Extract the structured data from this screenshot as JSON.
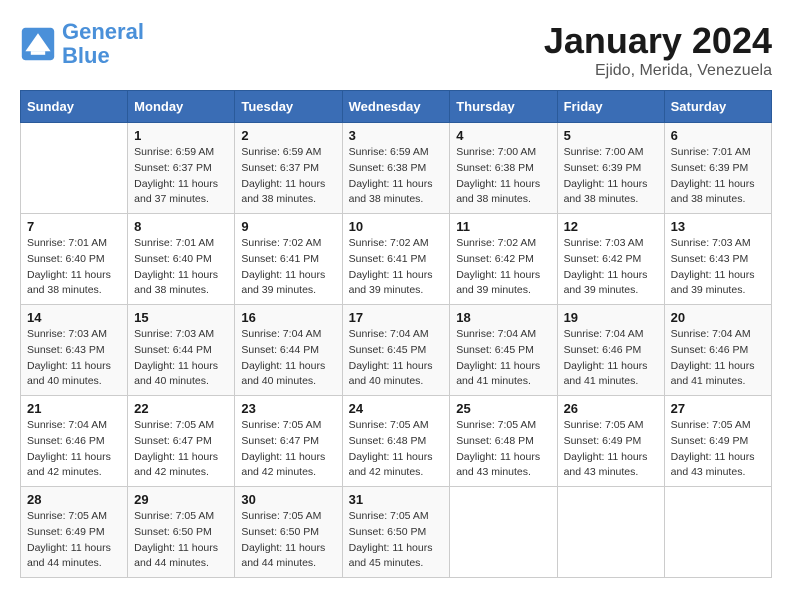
{
  "header": {
    "logo_line1": "General",
    "logo_line2": "Blue",
    "title": "January 2024",
    "subtitle": "Ejido, Merida, Venezuela"
  },
  "weekdays": [
    "Sunday",
    "Monday",
    "Tuesday",
    "Wednesday",
    "Thursday",
    "Friday",
    "Saturday"
  ],
  "weeks": [
    [
      {
        "day": "",
        "sunrise": "",
        "sunset": "",
        "daylight": ""
      },
      {
        "day": "1",
        "sunrise": "Sunrise: 6:59 AM",
        "sunset": "Sunset: 6:37 PM",
        "daylight": "Daylight: 11 hours and 37 minutes."
      },
      {
        "day": "2",
        "sunrise": "Sunrise: 6:59 AM",
        "sunset": "Sunset: 6:37 PM",
        "daylight": "Daylight: 11 hours and 38 minutes."
      },
      {
        "day": "3",
        "sunrise": "Sunrise: 6:59 AM",
        "sunset": "Sunset: 6:38 PM",
        "daylight": "Daylight: 11 hours and 38 minutes."
      },
      {
        "day": "4",
        "sunrise": "Sunrise: 7:00 AM",
        "sunset": "Sunset: 6:38 PM",
        "daylight": "Daylight: 11 hours and 38 minutes."
      },
      {
        "day": "5",
        "sunrise": "Sunrise: 7:00 AM",
        "sunset": "Sunset: 6:39 PM",
        "daylight": "Daylight: 11 hours and 38 minutes."
      },
      {
        "day": "6",
        "sunrise": "Sunrise: 7:01 AM",
        "sunset": "Sunset: 6:39 PM",
        "daylight": "Daylight: 11 hours and 38 minutes."
      }
    ],
    [
      {
        "day": "7",
        "sunrise": "Sunrise: 7:01 AM",
        "sunset": "Sunset: 6:40 PM",
        "daylight": "Daylight: 11 hours and 38 minutes."
      },
      {
        "day": "8",
        "sunrise": "Sunrise: 7:01 AM",
        "sunset": "Sunset: 6:40 PM",
        "daylight": "Daylight: 11 hours and 38 minutes."
      },
      {
        "day": "9",
        "sunrise": "Sunrise: 7:02 AM",
        "sunset": "Sunset: 6:41 PM",
        "daylight": "Daylight: 11 hours and 39 minutes."
      },
      {
        "day": "10",
        "sunrise": "Sunrise: 7:02 AM",
        "sunset": "Sunset: 6:41 PM",
        "daylight": "Daylight: 11 hours and 39 minutes."
      },
      {
        "day": "11",
        "sunrise": "Sunrise: 7:02 AM",
        "sunset": "Sunset: 6:42 PM",
        "daylight": "Daylight: 11 hours and 39 minutes."
      },
      {
        "day": "12",
        "sunrise": "Sunrise: 7:03 AM",
        "sunset": "Sunset: 6:42 PM",
        "daylight": "Daylight: 11 hours and 39 minutes."
      },
      {
        "day": "13",
        "sunrise": "Sunrise: 7:03 AM",
        "sunset": "Sunset: 6:43 PM",
        "daylight": "Daylight: 11 hours and 39 minutes."
      }
    ],
    [
      {
        "day": "14",
        "sunrise": "Sunrise: 7:03 AM",
        "sunset": "Sunset: 6:43 PM",
        "daylight": "Daylight: 11 hours and 40 minutes."
      },
      {
        "day": "15",
        "sunrise": "Sunrise: 7:03 AM",
        "sunset": "Sunset: 6:44 PM",
        "daylight": "Daylight: 11 hours and 40 minutes."
      },
      {
        "day": "16",
        "sunrise": "Sunrise: 7:04 AM",
        "sunset": "Sunset: 6:44 PM",
        "daylight": "Daylight: 11 hours and 40 minutes."
      },
      {
        "day": "17",
        "sunrise": "Sunrise: 7:04 AM",
        "sunset": "Sunset: 6:45 PM",
        "daylight": "Daylight: 11 hours and 40 minutes."
      },
      {
        "day": "18",
        "sunrise": "Sunrise: 7:04 AM",
        "sunset": "Sunset: 6:45 PM",
        "daylight": "Daylight: 11 hours and 41 minutes."
      },
      {
        "day": "19",
        "sunrise": "Sunrise: 7:04 AM",
        "sunset": "Sunset: 6:46 PM",
        "daylight": "Daylight: 11 hours and 41 minutes."
      },
      {
        "day": "20",
        "sunrise": "Sunrise: 7:04 AM",
        "sunset": "Sunset: 6:46 PM",
        "daylight": "Daylight: 11 hours and 41 minutes."
      }
    ],
    [
      {
        "day": "21",
        "sunrise": "Sunrise: 7:04 AM",
        "sunset": "Sunset: 6:46 PM",
        "daylight": "Daylight: 11 hours and 42 minutes."
      },
      {
        "day": "22",
        "sunrise": "Sunrise: 7:05 AM",
        "sunset": "Sunset: 6:47 PM",
        "daylight": "Daylight: 11 hours and 42 minutes."
      },
      {
        "day": "23",
        "sunrise": "Sunrise: 7:05 AM",
        "sunset": "Sunset: 6:47 PM",
        "daylight": "Daylight: 11 hours and 42 minutes."
      },
      {
        "day": "24",
        "sunrise": "Sunrise: 7:05 AM",
        "sunset": "Sunset: 6:48 PM",
        "daylight": "Daylight: 11 hours and 42 minutes."
      },
      {
        "day": "25",
        "sunrise": "Sunrise: 7:05 AM",
        "sunset": "Sunset: 6:48 PM",
        "daylight": "Daylight: 11 hours and 43 minutes."
      },
      {
        "day": "26",
        "sunrise": "Sunrise: 7:05 AM",
        "sunset": "Sunset: 6:49 PM",
        "daylight": "Daylight: 11 hours and 43 minutes."
      },
      {
        "day": "27",
        "sunrise": "Sunrise: 7:05 AM",
        "sunset": "Sunset: 6:49 PM",
        "daylight": "Daylight: 11 hours and 43 minutes."
      }
    ],
    [
      {
        "day": "28",
        "sunrise": "Sunrise: 7:05 AM",
        "sunset": "Sunset: 6:49 PM",
        "daylight": "Daylight: 11 hours and 44 minutes."
      },
      {
        "day": "29",
        "sunrise": "Sunrise: 7:05 AM",
        "sunset": "Sunset: 6:50 PM",
        "daylight": "Daylight: 11 hours and 44 minutes."
      },
      {
        "day": "30",
        "sunrise": "Sunrise: 7:05 AM",
        "sunset": "Sunset: 6:50 PM",
        "daylight": "Daylight: 11 hours and 44 minutes."
      },
      {
        "day": "31",
        "sunrise": "Sunrise: 7:05 AM",
        "sunset": "Sunset: 6:50 PM",
        "daylight": "Daylight: 11 hours and 45 minutes."
      },
      {
        "day": "",
        "sunrise": "",
        "sunset": "",
        "daylight": ""
      },
      {
        "day": "",
        "sunrise": "",
        "sunset": "",
        "daylight": ""
      },
      {
        "day": "",
        "sunrise": "",
        "sunset": "",
        "daylight": ""
      }
    ]
  ]
}
